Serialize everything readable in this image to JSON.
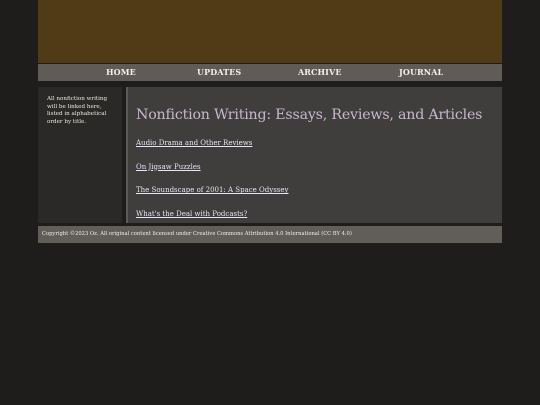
{
  "nav": {
    "items": [
      {
        "label": "HOME"
      },
      {
        "label": "UPDATES"
      },
      {
        "label": "ARCHIVE"
      },
      {
        "label": "JOURNAL"
      }
    ]
  },
  "sidebar": {
    "text": "All nonfiction writing will be linked here, listed in alphabetical order by title."
  },
  "main": {
    "title": "Nonfiction Writing: Essays, Reviews, and Articles",
    "links": [
      {
        "label": "Audio Drama and Other Reviews"
      },
      {
        "label": "On Jigsaw Puzzles"
      },
      {
        "label": "The Soundscape of 2001: A Space Odyssey"
      },
      {
        "label": "What's the Deal with Podcasts?"
      }
    ]
  },
  "footer": {
    "text": "Copyright ©2023 Oz. All original content licensed under Creative Commons Attribution 4.0 International (CC BY 4.0)"
  },
  "colors": {
    "page_background": "#1e1d1b",
    "banner": "#513b16",
    "nav_bar": "#5f5c58",
    "title": "#c5b8cc",
    "link": "#e9e4f2"
  }
}
